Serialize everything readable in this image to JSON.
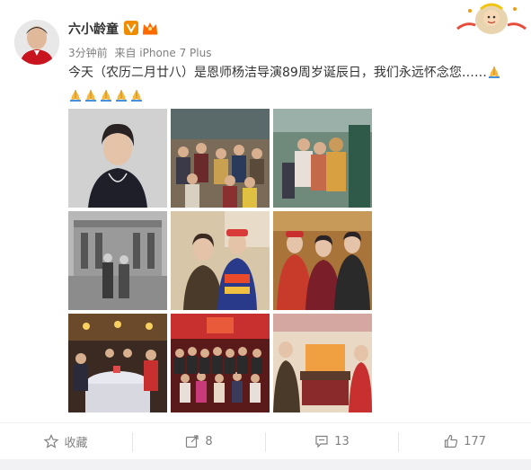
{
  "post": {
    "username": "六小龄童",
    "time": "3分钟前",
    "source": "来自 iPhone 7 Plus",
    "text": "今天（农历二月廿八）是恩师杨洁导演89周岁诞辰日，我们永远怀念您……"
  },
  "photos": [
    {
      "name": "photo-portrait",
      "caption": ""
    },
    {
      "name": "photo-crowd",
      "caption": ""
    },
    {
      "name": "photo-monkey-king",
      "caption": ""
    },
    {
      "name": "photo-building",
      "caption": ""
    },
    {
      "name": "photo-two-seated",
      "caption": ""
    },
    {
      "name": "photo-three-people",
      "caption": ""
    },
    {
      "name": "photo-banquet",
      "caption": ""
    },
    {
      "name": "photo-group",
      "caption": ""
    },
    {
      "name": "photo-living-room",
      "caption": ""
    }
  ],
  "actions": {
    "favorite_label": "收藏",
    "repost_count": "8",
    "comment_count": "13",
    "like_count": "177"
  },
  "colors": {
    "username": "#333333",
    "meta": "#808080",
    "vip_badge": "#f08c00",
    "crown": "#ff6a00"
  }
}
